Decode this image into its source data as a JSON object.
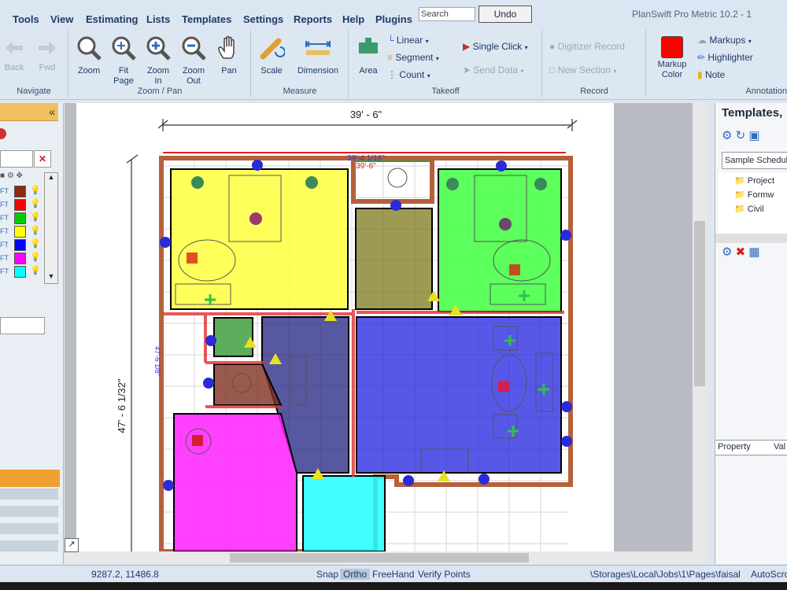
{
  "menu": {
    "items": [
      "Tools",
      "View",
      "Estimating",
      "Lists",
      "Templates",
      "Settings",
      "Reports",
      "Help",
      "Plugins"
    ],
    "search_placeholder": "Search",
    "undo_label": "Undo",
    "app_title": "PlanSwift Pro Metric 10.2 - 1"
  },
  "ribbon": {
    "navigate": {
      "label": "Navigate",
      "back": "Back",
      "fwd": "Fwd"
    },
    "zoom_pan": {
      "label": "Zoom / Pan",
      "zoom": "Zoom",
      "fit_page": "Fit Page",
      "zoom_in": "Zoom In",
      "zoom_out": "Zoom Out",
      "pan": "Pan"
    },
    "measure": {
      "label": "Measure",
      "scale": "Scale",
      "dimension": "Dimension"
    },
    "takeoff": {
      "label": "Takeoff",
      "area": "Area",
      "linear": "Linear",
      "segment": "Segment",
      "count": "Count",
      "single_click": "Single Click",
      "send_data": "Send Data"
    },
    "record": {
      "label": "Record",
      "digitizer_record": "Digitizer Record",
      "new_section": "New Section"
    },
    "annotation": {
      "label": "Annotation",
      "markup_color": "Markup Color",
      "markups": "Markups",
      "highlighter": "Highlighter",
      "note": "Note",
      "markup_color_value": "#ff0000"
    }
  },
  "drawing": {
    "dim_top": "39' - 6\"",
    "dim_blue": "39'-4 1/16\"",
    "dim_red": "39'-6\"",
    "dim_left": "47' - 6 1/32\"",
    "dim_vertical_small": "47'-6 1/8\""
  },
  "right_panel": {
    "title": "Templates,",
    "dropdown": "Sample Schedule",
    "tree": [
      "Project",
      "Formw",
      "Civil"
    ],
    "property_col": "Property",
    "value_col": "Val"
  },
  "status": {
    "coords": "9287.2, 11486.8",
    "snap": "Snap",
    "ortho": "Ortho",
    "freehand": "FreeHand",
    "verify_points": "Verify Points",
    "path": "\\Storages\\Local\\Jobs\\1\\Pages\\faisal",
    "autoscroll": "AutoScro"
  },
  "left_panel": {
    "swatches": [
      "#8b2a10",
      "#ff0000",
      "#00cc00",
      "#ffff00",
      "#0000ff",
      "#ff00ff",
      "#00ffff"
    ],
    "row_tags": [
      "FT",
      "FT",
      "FT",
      "FT",
      "FT",
      "FT",
      "FT"
    ],
    "chevron": "«"
  }
}
